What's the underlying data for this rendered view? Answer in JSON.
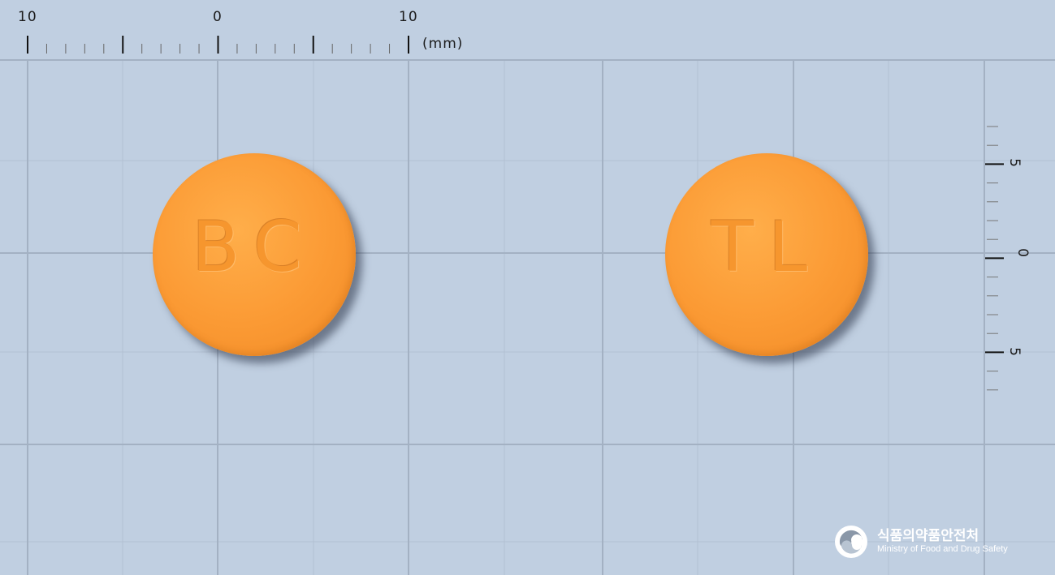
{
  "ruler_top": {
    "labels": [
      "10",
      "0",
      "10"
    ],
    "unit": "(mm)"
  },
  "ruler_right": {
    "labels": [
      "5",
      "0",
      "5"
    ]
  },
  "tablets": [
    {
      "imprint": "BC",
      "color": "#fb9a34"
    },
    {
      "imprint": "TL",
      "color": "#fb9a34"
    }
  ],
  "logo": {
    "korean": "식품의약품안전처",
    "english": "Ministry of Food and Drug Safety"
  },
  "colors": {
    "background": "#c0cfe1",
    "grid_major": "#a3b1c3",
    "grid_minor": "#b2c0d2"
  }
}
